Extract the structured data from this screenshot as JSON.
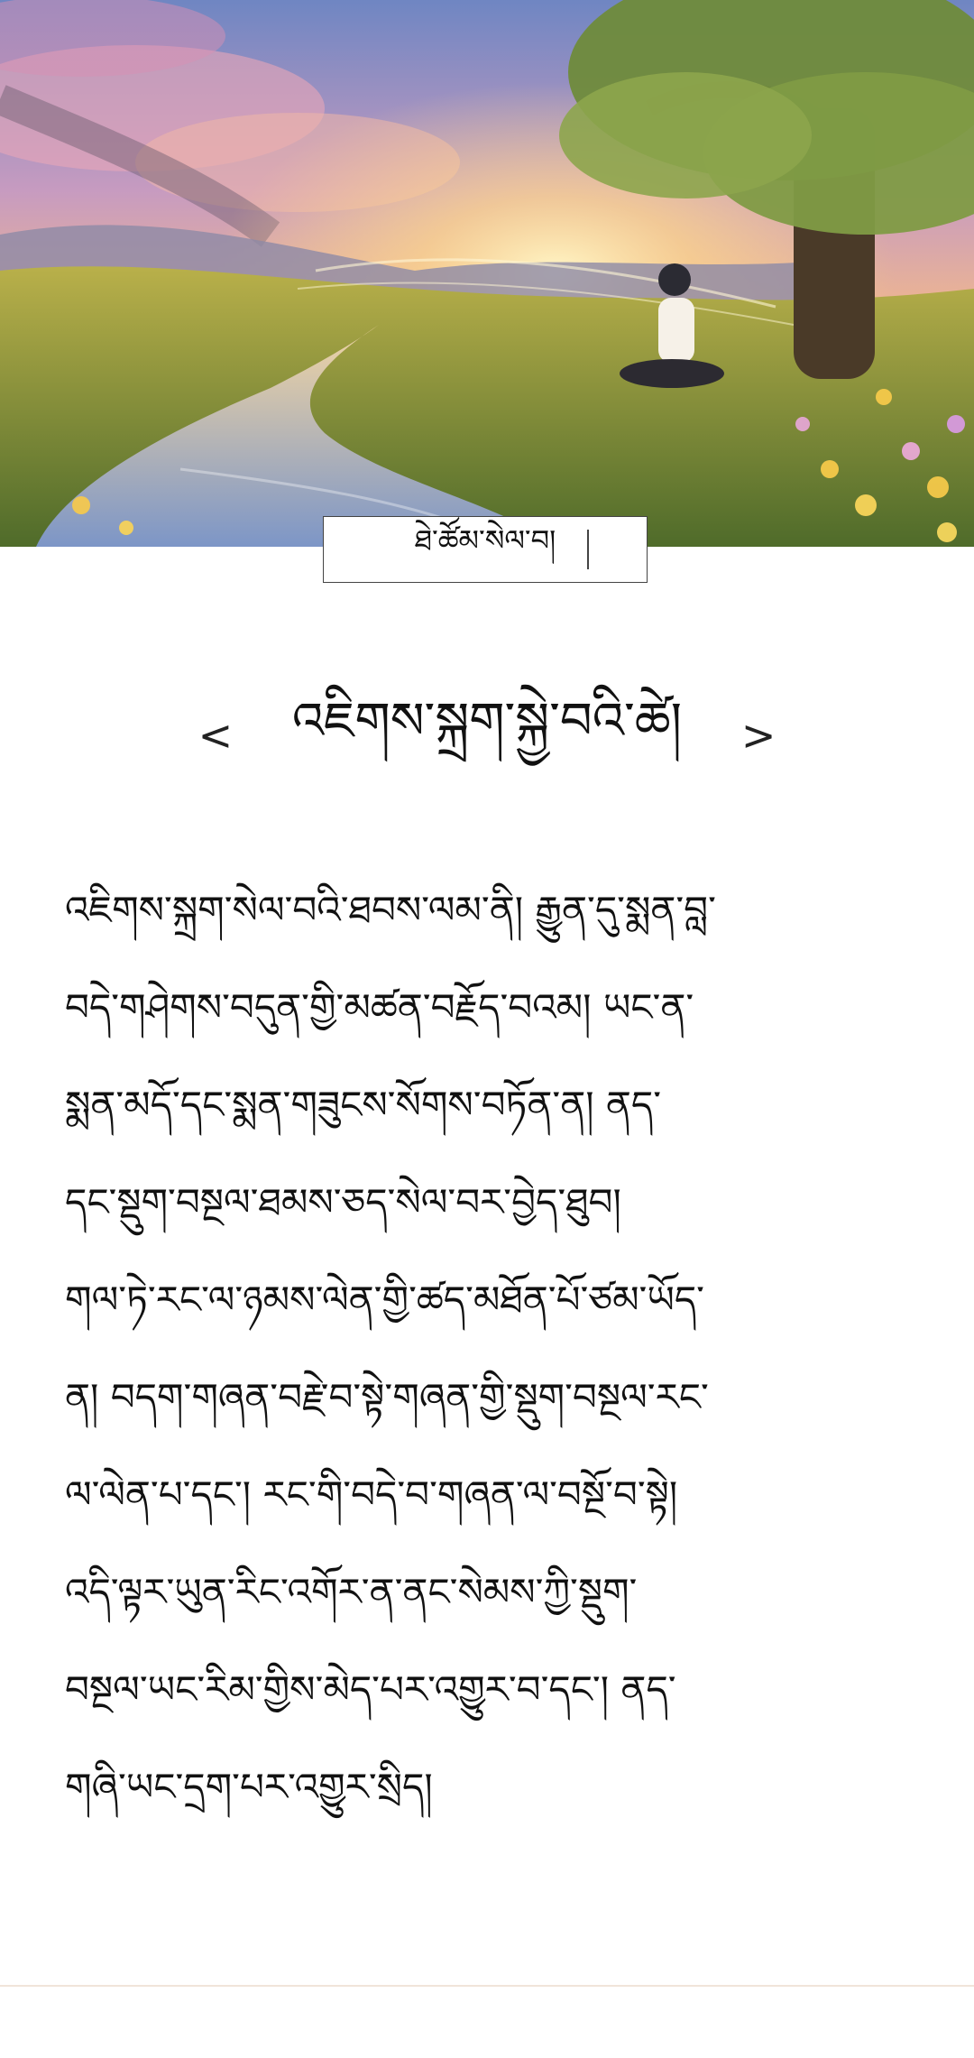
{
  "hero": {
    "image_label": "sunset-meditation-illustration"
  },
  "tag": {
    "label": "ཐེ་ཚོམ་སེལ་བ།"
  },
  "title_nav": {
    "prev": "<",
    "title": "འཇིགས་སྐྲག་སྐྱེ་བའི་ཚེ།",
    "next": ">"
  },
  "body": {
    "lines": [
      "འཇིགས་སྐྲག་སེལ་བའི་ཐབས་ལམ་ནི། རྒྱུན་དུ་སྨན་བླ་",
      "བདེ་གཤེགས་བདུན་གྱི་མཚན་བརྗོད་བའམ། ཡང་ན་",
      "སྨན་མདོ་དང་སྨན་གཟུངས་སོགས་བཏོན་ན། ནད་",
      "དང་སྡུག་བསྔལ་ཐམས་ཅད་སེལ་བར་བྱེད་ཐུབ།",
      "གལ་ཏེ་རང་ལ་ཉམས་ལེན་གྱི་ཚད་མཐོན་པོ་ཙམ་ཡོད་",
      "ན། བདག་གཞན་བརྗེ་བ་སྟེ་གཞན་གྱི་སྡུག་བསྔལ་རང་",
      "ལ་ལེན་པ་དང་། རང་གི་བདེ་བ་གཞན་ལ་བསྔོ་བ་སྟེ།",
      "འདི་ལྟར་ཡུན་རིང་འགོར་ན་ནང་སེམས་ཀྱི་སྡུག་",
      "བསྔལ་ཡང་རིམ་གྱིས་མེད་པར་འགྱུར་བ་དང་། ནད་",
      "གཞི་ཡང་དྲག་པར་འགྱུར་སྲིད།"
    ]
  },
  "colors": {
    "sky_top": "#6f86c2",
    "sunset": "#f6c46a",
    "grass": "#7f9a3a",
    "river": "#8fa7d6",
    "divider": "#f1e4da"
  }
}
